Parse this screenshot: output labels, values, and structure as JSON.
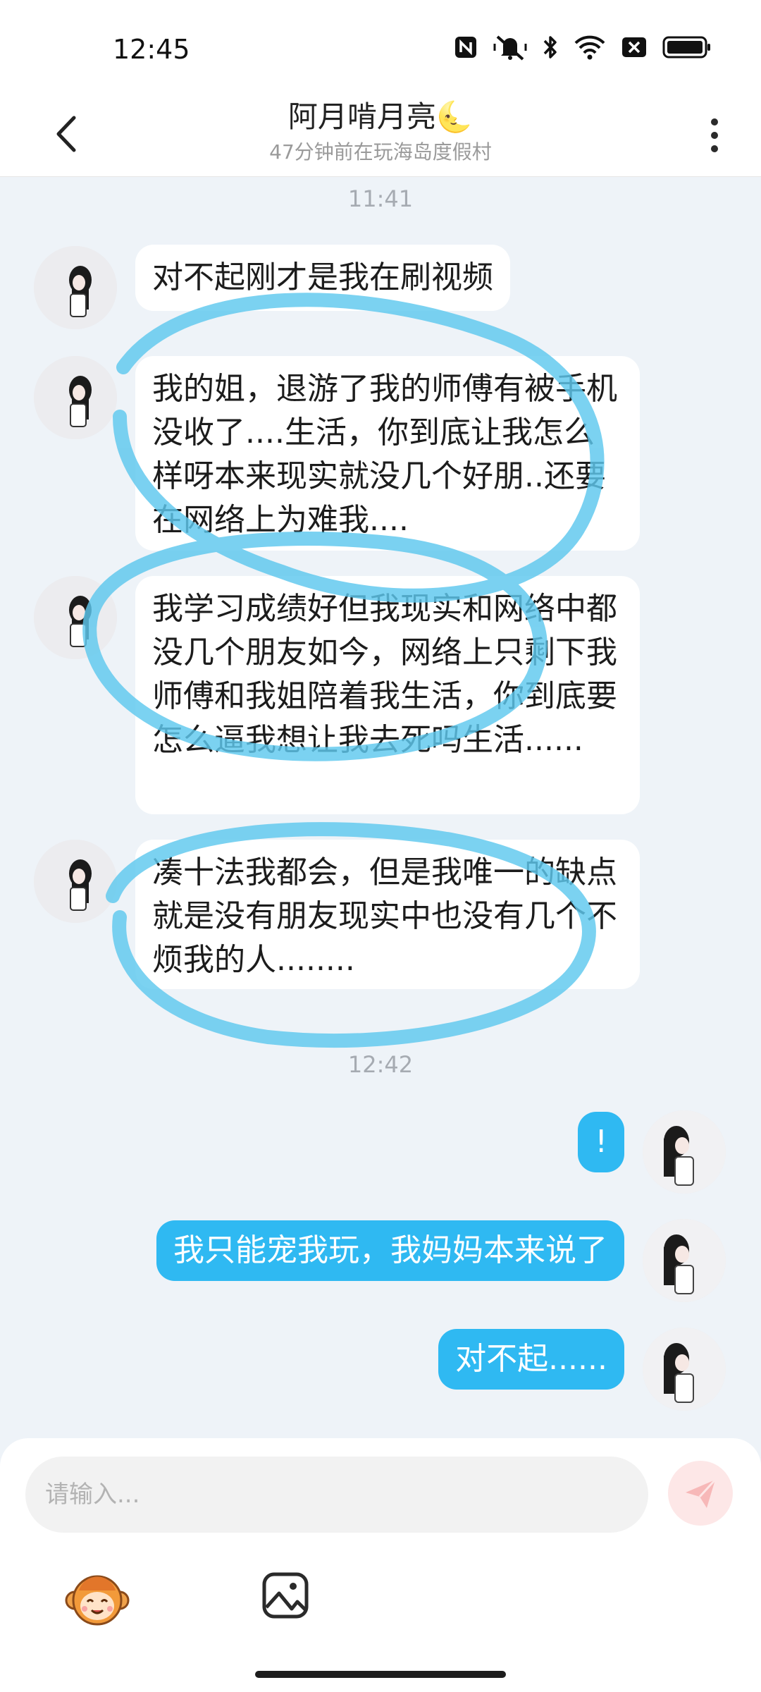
{
  "status_bar": {
    "time": "12:45",
    "icons": [
      "nfc-icon",
      "mute-vibrate-icon",
      "bluetooth-icon",
      "wifi-icon",
      "no-sim-icon",
      "battery-icon"
    ]
  },
  "header": {
    "title": "阿月啃月亮🌜",
    "subtitle": "47分钟前在玩海岛度假村"
  },
  "chat": {
    "timestamp_1": "11:41",
    "incoming": [
      {
        "text": "对不起刚才是我在刷视频"
      },
      {
        "text": "我的姐，退游了我的师傅有被手机没收了....生活，你到底让我怎么样呀本来现实就没几个好朋..还要在网络上为难我...."
      },
      {
        "text": "我学习成绩好但我现实和网络中都没几个朋友如今，网络上只剩下我师傅和我姐陪着我生活，你到底要怎么逼我想让我去死吗生活......"
      },
      {
        "text": "凑十法我都会，但是我唯一的缺点就是没有朋友现实中也没有几个不烦我的人........"
      }
    ],
    "timestamp_2": "12:42",
    "outgoing": [
      {
        "text": "!"
      },
      {
        "text": "我只能宠我玩，我妈妈本来说了"
      },
      {
        "text": "对不起......"
      }
    ],
    "scribble_color": "#5ec8ee"
  },
  "composer": {
    "placeholder": "请输入...",
    "value": ""
  },
  "colors": {
    "accent": "#2fb9f2",
    "background": "#eef3f8"
  }
}
